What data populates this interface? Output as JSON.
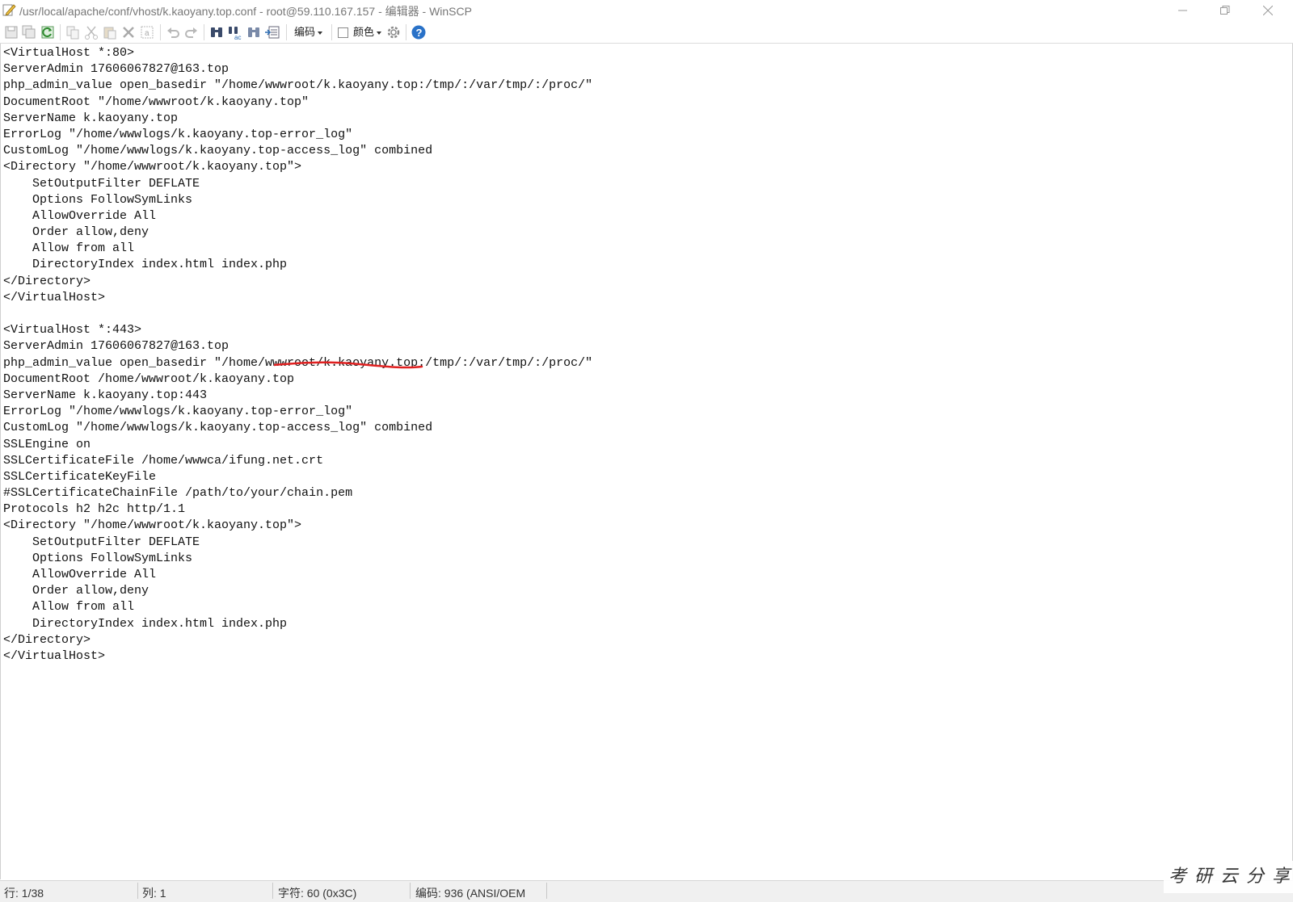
{
  "window": {
    "title": "/usr/local/apache/conf/vhost/k.kaoyany.top.conf - root@59.110.167.157 - 编辑器 - WinSCP",
    "title_icon": "edit-pencil-icon"
  },
  "toolbar": {
    "encoding_label": "编码",
    "color_label": "颜色",
    "color_checked": false,
    "icons": [
      "save-icon",
      "save-all-icon",
      "reload-icon",
      "copy-icon",
      "cut-icon",
      "paste-icon",
      "delete-icon",
      "select-all-icon",
      "undo-icon",
      "redo-icon",
      "find-icon",
      "replace-icon",
      "find-next-icon",
      "goto-line-icon",
      "settings-icon",
      "help-icon"
    ]
  },
  "editor": {
    "lines": [
      "<VirtualHost *:80>",
      "ServerAdmin 17606067827@163.top",
      "php_admin_value open_basedir \"/home/wwwroot/k.kaoyany.top:/tmp/:/var/tmp/:/proc/\"",
      "DocumentRoot \"/home/wwwroot/k.kaoyany.top\"",
      "ServerName k.kaoyany.top",
      "ErrorLog \"/home/wwwlogs/k.kaoyany.top-error_log\"",
      "CustomLog \"/home/wwwlogs/k.kaoyany.top-access_log\" combined",
      "<Directory \"/home/wwwroot/k.kaoyany.top\">",
      "    SetOutputFilter DEFLATE",
      "    Options FollowSymLinks",
      "    AllowOverride All",
      "    Order allow,deny",
      "    Allow from all",
      "    DirectoryIndex index.html index.php",
      "</Directory>",
      "</VirtualHost>",
      "",
      "<VirtualHost *:443>",
      "ServerAdmin 17606067827@163.top",
      "php_admin_value open_basedir \"/home/wwwroot/k.kaoyany.top:/tmp/:/var/tmp/:/proc/\"",
      "DocumentRoot /home/wwwroot/k.kaoyany.top",
      "ServerName k.kaoyany.top:443",
      "ErrorLog \"/home/wwwlogs/k.kaoyany.top-error_log\"",
      "CustomLog \"/home/wwwlogs/k.kaoyany.top-access_log\" combined",
      "SSLEngine on",
      "SSLCertificateFile /home/wwwca/ifung.net.crt",
      "SSLCertificateKeyFile",
      "#SSLCertificateChainFile /path/to/your/chain.pem",
      "Protocols h2 h2c http/1.1",
      "<Directory \"/home/wwwroot/k.kaoyany.top\">",
      "    SetOutputFilter DEFLATE",
      "    Options FollowSymLinks",
      "    AllowOverride All",
      "    Order allow,deny",
      "    Allow from all",
      "    DirectoryIndex index.html index.php",
      "</Directory>",
      "</VirtualHost>"
    ],
    "annotation_color": "#e02020"
  },
  "status": {
    "line": "行: 1/38",
    "column": "列: 1",
    "char": "字符: 60 (0x3C)",
    "encoding": "编码: 936  (ANSI/OEM"
  },
  "watermark": "考研云分享"
}
